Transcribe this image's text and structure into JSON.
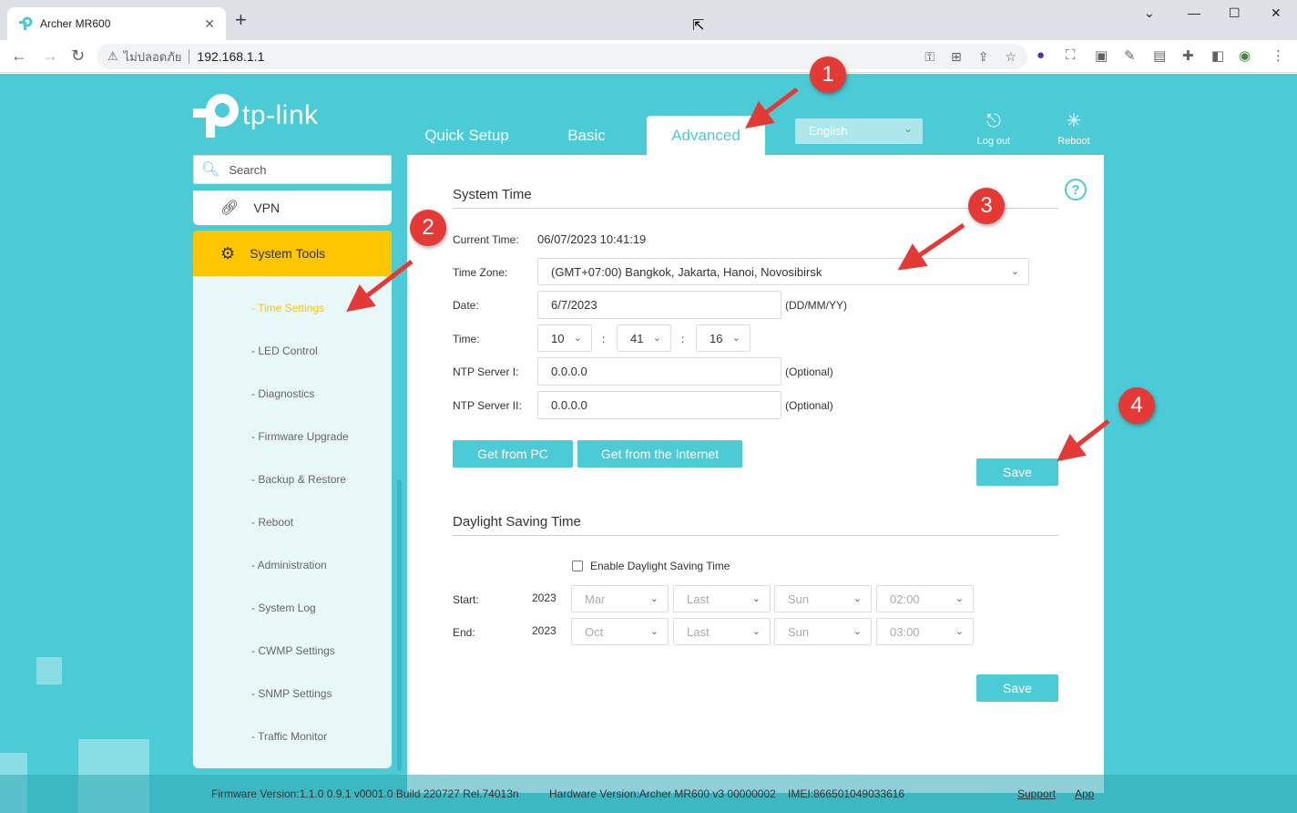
{
  "browser": {
    "tab_title": "Archer MR600",
    "new_tab": "+",
    "insecure_label": "ไม่ปลอดภัย",
    "url": "192.168.1.1"
  },
  "header": {
    "brand": "tp-link",
    "tabs": [
      {
        "label": "Quick Setup"
      },
      {
        "label": "Basic"
      },
      {
        "label": "Advanced"
      }
    ],
    "language": "English",
    "logout_label": "Log out",
    "reboot_label": "Reboot"
  },
  "sidebar": {
    "search_placeholder": "Search",
    "vpn_label": "VPN",
    "system_tools_label": "System Tools",
    "sub_items": [
      {
        "label": "- Time Settings"
      },
      {
        "label": "- LED Control"
      },
      {
        "label": "- Diagnostics"
      },
      {
        "label": "- Firmware Upgrade"
      },
      {
        "label": "- Backup & Restore"
      },
      {
        "label": "- Reboot"
      },
      {
        "label": "- Administration"
      },
      {
        "label": "- System Log"
      },
      {
        "label": "- CWMP Settings"
      },
      {
        "label": "- SNMP Settings"
      },
      {
        "label": "- Traffic Monitor"
      }
    ]
  },
  "system_time": {
    "title": "System Time",
    "current_time_label": "Current Time:",
    "current_time": "06/07/2023 10:41:19",
    "time_zone_label": "Time Zone:",
    "time_zone": "(GMT+07:00) Bangkok, Jakarta, Hanoi, Novosibirsk",
    "date_label": "Date:",
    "date": "6/7/2023",
    "date_format": "(DD/MM/YY)",
    "time_label": "Time:",
    "hour": "10",
    "minute": "41",
    "second": "16",
    "colon": ":",
    "ntp1_label": "NTP Server I:",
    "ntp1": "0.0.0.0",
    "ntp2_label": "NTP Server II:",
    "ntp2": "0.0.0.0",
    "optional": "(Optional)",
    "get_pc": "Get from PC",
    "get_internet": "Get from the Internet",
    "save": "Save"
  },
  "dst": {
    "title": "Daylight Saving Time",
    "enable_label": "Enable Daylight Saving Time",
    "start_label": "Start:",
    "start_year": "2023",
    "start_month": "Mar",
    "start_week": "Last",
    "start_day": "Sun",
    "start_time": "02:00",
    "end_label": "End:",
    "end_year": "2023",
    "end_month": "Oct",
    "end_week": "Last",
    "end_day": "Sun",
    "end_time": "03:00",
    "save": "Save"
  },
  "footer": {
    "firmware": "Firmware Version:1.1.0 0.9.1 v0001.0 Build 220727 Rel.74013n",
    "hardware": "Hardware Version:Archer MR600 v3 00000002",
    "imei": "IMEI:866501049033616",
    "support": "Support",
    "app": "App"
  },
  "annotations": [
    "1",
    "2",
    "3",
    "4"
  ],
  "colors": {
    "accent": "#4acbd6",
    "highlight": "#fec600",
    "annotation": "#e53935"
  }
}
